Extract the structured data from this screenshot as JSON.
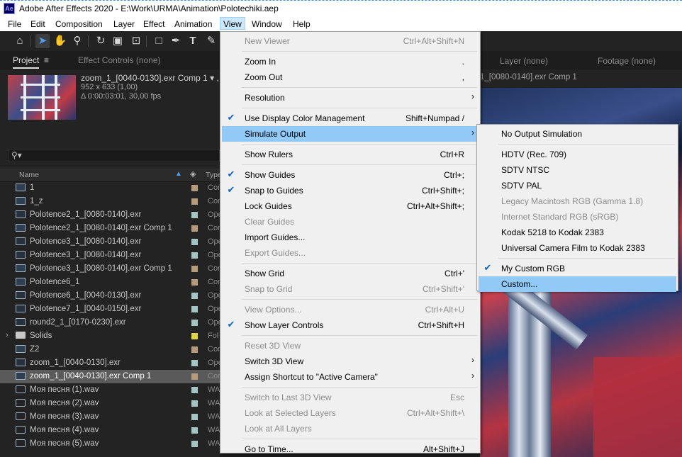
{
  "titlebar": {
    "logo": "Ae",
    "title": "Adobe After Effects 2020 - E:\\Work\\URMA\\Animation\\Polotechiki.aep"
  },
  "menubar": [
    "File",
    "Edit",
    "Composition",
    "Layer",
    "Effect",
    "Animation",
    "View",
    "Window",
    "Help"
  ],
  "active_menu": "View",
  "panels": {
    "project_tab": "Project",
    "effect_controls_tab": "Effect Controls (none)",
    "layer_tab": "Layer (none)",
    "footage_tab": "Footage (none)",
    "comp_tab_fragment": "1_[0080-0140].exr Comp 1"
  },
  "preview": {
    "name": "zoom_1_[0040-0130].exr Comp 1 ▾ ,",
    "size": "952 x 633 (1,00)",
    "duration": "Δ 0:00:03:01, 30,00 fps"
  },
  "search": {
    "icon": "magnifier-icon"
  },
  "columns": {
    "name": "Name",
    "type": "Type"
  },
  "files": [
    {
      "name": "1",
      "type": "Con",
      "color": "#b79a7c",
      "icon": "comp"
    },
    {
      "name": "1_z",
      "type": "Con",
      "color": "#b79a7c",
      "icon": "comp"
    },
    {
      "name": "Polotence2_1_[0080-0140].exr",
      "type": "Ope",
      "color": "#a4c5c5",
      "icon": "footage"
    },
    {
      "name": "Polotence2_1_[0080-0140].exr Comp 1",
      "type": "Con",
      "color": "#b79a7c",
      "icon": "comp"
    },
    {
      "name": "Polotence3_1_[0080-0140].exr",
      "type": "Ope",
      "color": "#a4c5c5",
      "icon": "footage"
    },
    {
      "name": "Polotence3_1_[0080-0140].exr",
      "type": "Ope",
      "color": "#a4c5c5",
      "icon": "footage"
    },
    {
      "name": "Polotence3_1_[0080-0140].exr Comp 1",
      "type": "Con",
      "color": "#b79a7c",
      "icon": "comp"
    },
    {
      "name": "Polotence6_1",
      "type": "Con",
      "color": "#b79a7c",
      "icon": "comp"
    },
    {
      "name": "Polotence6_1_[0040-0130].exr",
      "type": "Ope",
      "color": "#a4c5c5",
      "icon": "footage"
    },
    {
      "name": "Polotence7_1_[0040-0150].exr",
      "type": "Ope",
      "color": "#a4c5c5",
      "icon": "footage"
    },
    {
      "name": "round2_1_[0170-0230].exr",
      "type": "Ope",
      "color": "#a4c5c5",
      "icon": "footage"
    },
    {
      "name": "Solids",
      "type": "Fol",
      "color": "#e2d34a",
      "icon": "folder"
    },
    {
      "name": "Z2",
      "type": "Con",
      "color": "#b79a7c",
      "icon": "comp"
    },
    {
      "name": "zoom_1_[0040-0130].exr",
      "type": "Ope",
      "color": "#a4c5c5",
      "icon": "footage"
    },
    {
      "name": "zoom_1_[0040-0130].exr Comp 1",
      "type": "Con",
      "color": "#b79a7c",
      "icon": "comp",
      "selected": true
    },
    {
      "name": "Моя песня (1).wav",
      "type": "WA",
      "color": "#a4c5c5",
      "icon": "audio"
    },
    {
      "name": "Моя песня (2).wav",
      "type": "WA",
      "color": "#a4c5c5",
      "icon": "audio"
    },
    {
      "name": "Моя песня (3).wav",
      "type": "WA",
      "color": "#a4c5c5",
      "icon": "audio"
    },
    {
      "name": "Моя песня (4).wav",
      "type": "WA",
      "color": "#a4c5c5",
      "icon": "audio"
    },
    {
      "name": "Моя песня (5).wav",
      "type": "WA",
      "color": "#a4c5c5",
      "icon": "audio"
    }
  ],
  "view_menu": [
    {
      "label": "New Viewer",
      "shortcut": "Ctrl+Alt+Shift+N",
      "disabled": true,
      "sep_after": true
    },
    {
      "label": "Zoom In",
      "shortcut": "."
    },
    {
      "label": "Zoom Out",
      "shortcut": ",",
      "sep_after": true
    },
    {
      "label": "Resolution",
      "submenu": true,
      "sep_after": true
    },
    {
      "label": "Use Display Color Management",
      "shortcut": "Shift+Numpad /",
      "checked": true
    },
    {
      "label": "Simulate Output",
      "submenu": true,
      "highlighted": true,
      "sep_after": true
    },
    {
      "label": "Show Rulers",
      "shortcut": "Ctrl+R",
      "sep_after": true
    },
    {
      "label": "Show Guides",
      "shortcut": "Ctrl+;",
      "checked": true
    },
    {
      "label": "Snap to Guides",
      "shortcut": "Ctrl+Shift+;",
      "checked": true
    },
    {
      "label": "Lock Guides",
      "shortcut": "Ctrl+Alt+Shift+;"
    },
    {
      "label": "Clear Guides",
      "disabled": true
    },
    {
      "label": "Import Guides..."
    },
    {
      "label": "Export Guides...",
      "disabled": true,
      "sep_after": true
    },
    {
      "label": "Show Grid",
      "shortcut": "Ctrl+'"
    },
    {
      "label": "Snap to Grid",
      "shortcut": "Ctrl+Shift+'",
      "disabled": true,
      "sep_after": true
    },
    {
      "label": "View Options...",
      "shortcut": "Ctrl+Alt+U",
      "disabled": true
    },
    {
      "label": "Show Layer Controls",
      "shortcut": "Ctrl+Shift+H",
      "checked": true,
      "sep_after": true
    },
    {
      "label": "Reset 3D View",
      "disabled": true
    },
    {
      "label": "Switch 3D View",
      "submenu": true
    },
    {
      "label": "Assign Shortcut to \"Active Camera\"",
      "submenu": true,
      "sep_after": true
    },
    {
      "label": "Switch to Last 3D View",
      "shortcut": "Esc",
      "disabled": true
    },
    {
      "label": "Look at Selected Layers",
      "shortcut": "Ctrl+Alt+Shift+\\",
      "disabled": true
    },
    {
      "label": "Look at All Layers",
      "disabled": true,
      "sep_after": true
    },
    {
      "label": "Go to Time...",
      "shortcut": "Alt+Shift+J"
    }
  ],
  "simulate_submenu": [
    {
      "label": "No Output Simulation",
      "sep_after": true
    },
    {
      "label": "HDTV (Rec. 709)"
    },
    {
      "label": "SDTV NTSC"
    },
    {
      "label": "SDTV PAL"
    },
    {
      "label": "Legacy Macintosh RGB (Gamma 1.8)",
      "disabled": true
    },
    {
      "label": "Internet Standard RGB (sRGB)",
      "disabled": true
    },
    {
      "label": "Kodak 5218 to Kodak 2383"
    },
    {
      "label": "Universal Camera Film to Kodak 2383",
      "sep_after": true
    },
    {
      "label": "My Custom RGB",
      "checked": true
    },
    {
      "label": "Custom...",
      "highlighted": true
    }
  ]
}
